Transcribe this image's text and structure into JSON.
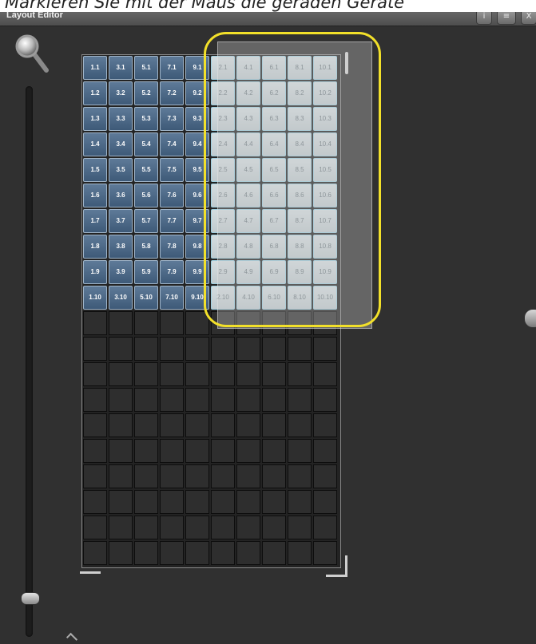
{
  "caption": "Markieren Sie mit der Maus die geraden Geräte",
  "window": {
    "title": "Layout Editor",
    "buttons": {
      "info": "i",
      "menu": "≡",
      "close": "X"
    }
  },
  "fixtures": [
    [
      "1.1",
      "3.1",
      "5.1",
      "7.1",
      "9.1",
      "2.1",
      "4.1",
      "6.1",
      "8.1",
      "10.1"
    ],
    [
      "1.2",
      "3.2",
      "5.2",
      "7.2",
      "9.2",
      "2.2",
      "4.2",
      "6.2",
      "8.2",
      "10.2"
    ],
    [
      "1.3",
      "3.3",
      "5.3",
      "7.3",
      "9.3",
      "2.3",
      "4.3",
      "6.3",
      "8.3",
      "10.3"
    ],
    [
      "1.4",
      "3.4",
      "5.4",
      "7.4",
      "9.4",
      "2.4",
      "4.4",
      "6.4",
      "8.4",
      "10.4"
    ],
    [
      "1.5",
      "3.5",
      "5.5",
      "7.5",
      "9.5",
      "2.5",
      "4.5",
      "6.5",
      "8.5",
      "10.5"
    ],
    [
      "1.6",
      "3.6",
      "5.6",
      "7.6",
      "9.6",
      "2.6",
      "4.6",
      "6.6",
      "8.6",
      "10.6"
    ],
    [
      "1.7",
      "3.7",
      "5.7",
      "7.7",
      "9.7",
      "2.7",
      "4.7",
      "6.7",
      "8.7",
      "10.7"
    ],
    [
      "1.8",
      "3.8",
      "5.8",
      "7.8",
      "9.8",
      "2.8",
      "4.8",
      "6.8",
      "8.8",
      "10.8"
    ],
    [
      "1.9",
      "3.9",
      "5.9",
      "7.9",
      "9.9",
      "2.9",
      "4.9",
      "6.9",
      "8.9",
      "10.9"
    ],
    [
      "1.10",
      "3.10",
      "5.10",
      "7.10",
      "9.10",
      "2.10",
      "4.10",
      "6.10",
      "8.10",
      "10.10"
    ]
  ],
  "selected_columns_from": 5,
  "empty_rows": 10,
  "colors": {
    "highlight": "#f2e02a",
    "fixture": "#4e6a88",
    "selected": "#cfd8dc"
  }
}
